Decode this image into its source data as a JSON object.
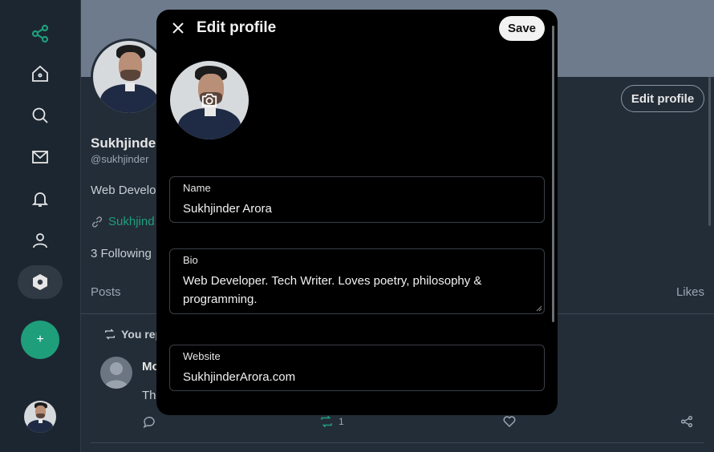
{
  "sidebar": {
    "items": [
      {
        "icon": "share-network-icon"
      },
      {
        "icon": "home-icon"
      },
      {
        "icon": "search-icon"
      },
      {
        "icon": "mail-icon"
      },
      {
        "icon": "bell-icon"
      },
      {
        "icon": "user-icon"
      },
      {
        "icon": "settings-hex-icon"
      }
    ],
    "fab_label": "+",
    "accent": "#1f9e7b"
  },
  "profile": {
    "edit_button": "Edit profile",
    "display_name": "Sukhjinder",
    "handle": "@sukhjinder",
    "bio_preview": "Web Develop",
    "link_preview": "Sukhjind",
    "following": "3 Following"
  },
  "tabs": {
    "posts": "Posts",
    "likes": "Likes"
  },
  "post": {
    "repost_label": "You rep",
    "author": "Mo",
    "text": "Th",
    "repost_count": "1"
  },
  "modal": {
    "title": "Edit profile",
    "save_label": "Save",
    "fields": {
      "name": {
        "label": "Name",
        "value": "Sukhjinder Arora"
      },
      "bio": {
        "label": "Bio",
        "value": "Web Developer. Tech Writer. Loves poetry, philosophy & programming."
      },
      "website": {
        "label": "Website",
        "value": "SukhjinderArora.com"
      }
    }
  }
}
